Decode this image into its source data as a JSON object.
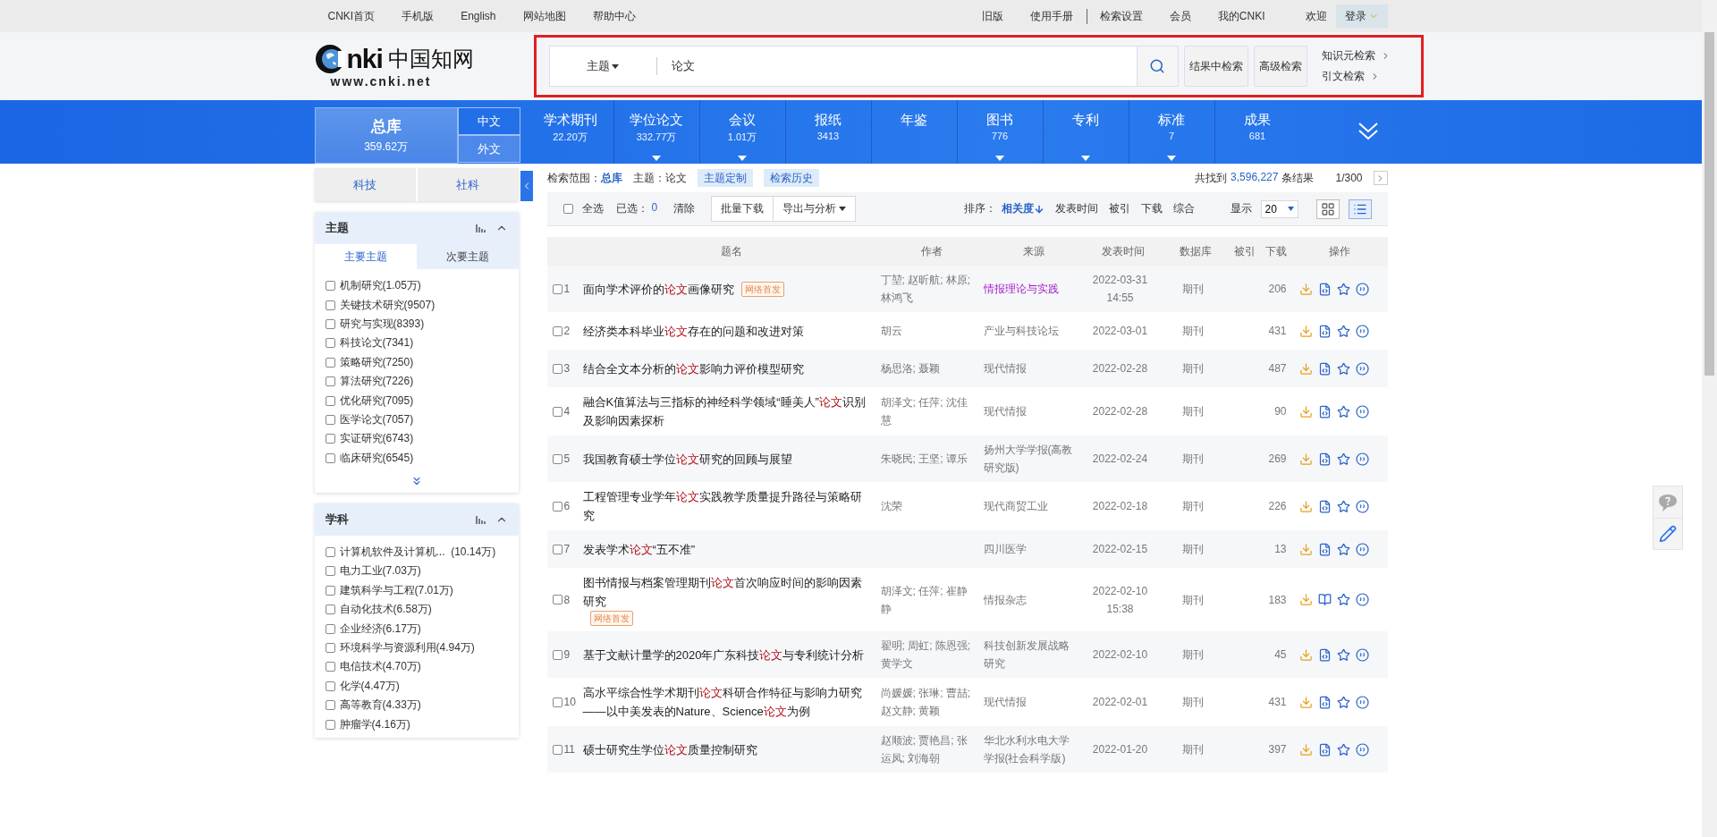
{
  "logo": {
    "wordmark": "nki",
    "name": "中国知网",
    "url": "www.cnki.net"
  },
  "top_links_left": [
    "CNKI首页",
    "手机版",
    "English",
    "网站地图",
    "帮助中心"
  ],
  "top_links_right": [
    {
      "label": "旧版",
      "separated": false
    },
    {
      "label": "使用手册",
      "separated": false
    },
    {
      "label": "检索设置",
      "separated": true
    },
    {
      "label": "会员",
      "separated": false
    },
    {
      "label": "我的CNKI",
      "separated": false
    }
  ],
  "welcome": "欢迎",
  "login": "登录",
  "search": {
    "field": "主题",
    "value": "论文",
    "buttons": [
      "结果中检索",
      "高级检索"
    ],
    "links": [
      "知识元检索",
      "引文检索"
    ]
  },
  "nav": {
    "all_label": "总库",
    "all_count": "359.62万",
    "langs": [
      "中文",
      "外文"
    ],
    "databases": [
      {
        "label": "学术期刊",
        "count": "22.20万",
        "has_menu": false
      },
      {
        "label": "学位论文",
        "count": "332.77万",
        "has_menu": true
      },
      {
        "label": "会议",
        "count": "1.01万",
        "has_menu": true
      },
      {
        "label": "报纸",
        "count": "3413",
        "has_menu": false
      },
      {
        "label": "年鉴",
        "has_menu": false
      },
      {
        "label": "图书",
        "count": "776",
        "has_menu": true
      },
      {
        "label": "专利",
        "has_menu": true
      },
      {
        "label": "标准",
        "count": "7",
        "has_menu": true
      },
      {
        "label": "成果",
        "count": "681",
        "has_menu": false
      }
    ]
  },
  "sidebar": {
    "scopes": [
      "科技",
      "社科"
    ],
    "facets": [
      {
        "title": "主题",
        "tabs": [
          {
            "label": "主要主题",
            "selected": true
          },
          {
            "label": "次要主题",
            "selected": false
          }
        ],
        "more": true,
        "items": [
          {
            "label": "机制研究(1.05万)",
            "checked": false
          },
          {
            "label": "关键技术研究(9507)",
            "checked": false
          },
          {
            "label": "研究与实现(8393)",
            "checked": false
          },
          {
            "label": "科技论文(7341)",
            "checked": false
          },
          {
            "label": "策略研究(7250)",
            "checked": false
          },
          {
            "label": "算法研究(7226)",
            "checked": false
          },
          {
            "label": "优化研究(7095)",
            "checked": false
          },
          {
            "label": "医学论文(7057)",
            "checked": false
          },
          {
            "label": "实证研究(6743)",
            "checked": false
          },
          {
            "label": "临床研究(6545)",
            "checked": false
          }
        ]
      },
      {
        "title": "学科",
        "more": false,
        "items": [
          {
            "label": "计算机软件及计算机...  (10.14万)",
            "checked": false
          },
          {
            "label": "电力工业(7.03万)",
            "checked": false
          },
          {
            "label": "建筑科学与工程(7.01万)",
            "checked": false
          },
          {
            "label": "自动化技术(6.58万)",
            "checked": false
          },
          {
            "label": "企业经济(6.17万)",
            "checked": false
          },
          {
            "label": "环境科学与资源利用(4.94万)",
            "checked": false
          },
          {
            "label": "电信技术(4.70万)",
            "checked": false
          },
          {
            "label": "化学(4.47万)",
            "checked": false
          },
          {
            "label": "高等教育(4.33万)",
            "checked": false
          },
          {
            "label": "肿瘤学(4.16万)",
            "checked": false
          }
        ]
      }
    ]
  },
  "results": {
    "scope_label": "检索范围：",
    "scope": "总库",
    "query": "主题：论文",
    "actions": [
      "主题定制",
      "检索历史"
    ],
    "found_prefix": "共找到",
    "found": "3,596,227",
    "found_suffix": "条结果",
    "page": "1/300"
  },
  "toolbar": {
    "select_all": "全选",
    "select_all_checked": false,
    "selected_label": "已选：",
    "selected_count": "0",
    "clear": "清除",
    "buttons": [
      {
        "label": "批量下载",
        "has_menu": false
      },
      {
        "label": "导出与分析",
        "has_menu": true
      }
    ],
    "sort_label": "排序：",
    "sorts": [
      {
        "label": "相关度",
        "selected": true
      },
      {
        "label": "发表时间",
        "selected": false
      },
      {
        "label": "被引",
        "selected": false
      },
      {
        "label": "下载",
        "selected": false
      },
      {
        "label": "综合",
        "selected": false
      }
    ],
    "show_label": "显示",
    "page_size": "20",
    "views": [
      {
        "kind": "grid",
        "selected": false
      },
      {
        "kind": "list",
        "selected": true
      }
    ]
  },
  "table": {
    "columns": [
      "题名",
      "作者",
      "来源",
      "发表时间",
      "数据库",
      "被引",
      "下载",
      "操作"
    ],
    "rows": [
      {
        "index": "1",
        "checked": false,
        "title": [
          {
            "text": "面向学术评价的",
            "highlight": false
          },
          {
            "text": "论文",
            "highlight": true
          },
          {
            "text": "画像研究",
            "highlight": false
          }
        ],
        "tag": "网络首发",
        "authors": "丁堃; 赵昕航; 林原; 林鸿飞",
        "source": "情报理论与实践",
        "visited": true,
        "date": "2022-03-31 14:55",
        "database": "期刊",
        "downloads": "206",
        "kind": "html"
      },
      {
        "index": "2",
        "checked": false,
        "title": [
          {
            "text": "经济类本科毕业",
            "highlight": false
          },
          {
            "text": "论文",
            "highlight": true
          },
          {
            "text": "存在的问题和改进对策",
            "highlight": false
          }
        ],
        "authors": "胡云",
        "source": "产业与科技论坛",
        "visited": false,
        "date": "2022-03-01",
        "database": "期刊",
        "downloads": "431",
        "kind": "html"
      },
      {
        "index": "3",
        "checked": false,
        "title": [
          {
            "text": "结合全文本分析的",
            "highlight": false
          },
          {
            "text": "论文",
            "highlight": true
          },
          {
            "text": "影响力评价模型研究",
            "highlight": false
          }
        ],
        "authors": "杨思洛; 聂颖",
        "source": "现代情报",
        "visited": false,
        "date": "2022-02-28",
        "database": "期刊",
        "downloads": "487",
        "kind": "html"
      },
      {
        "index": "4",
        "checked": false,
        "title": [
          {
            "text": "融合K值算法与三指标的神经科学领域“睡美人”",
            "highlight": false
          },
          {
            "text": "论文",
            "highlight": true
          },
          {
            "text": "识别及影响因素探析",
            "highlight": false
          }
        ],
        "authors": "胡泽文; 任萍; 沈佳慧",
        "source": "现代情报",
        "visited": false,
        "date": "2022-02-28",
        "database": "期刊",
        "downloads": "90",
        "kind": "html"
      },
      {
        "index": "5",
        "checked": false,
        "title": [
          {
            "text": "我国教育硕士学位",
            "highlight": false
          },
          {
            "text": "论文",
            "highlight": true
          },
          {
            "text": "研究的回顾与展望",
            "highlight": false
          }
        ],
        "authors": "朱晓民; 王坚; 谭乐",
        "source": "扬州大学学报(高教研究版)",
        "visited": false,
        "date": "2022-02-24",
        "database": "期刊",
        "downloads": "269",
        "kind": "html"
      },
      {
        "index": "6",
        "checked": false,
        "title": [
          {
            "text": "工程管理专业学年",
            "highlight": false
          },
          {
            "text": "论文",
            "highlight": true
          },
          {
            "text": "实践教学质量提升路径与策略研究",
            "highlight": false
          }
        ],
        "authors": "沈荣",
        "source": "现代商贸工业",
        "visited": false,
        "date": "2022-02-18",
        "database": "期刊",
        "downloads": "226",
        "kind": "html"
      },
      {
        "index": "7",
        "checked": false,
        "title": [
          {
            "text": "发表学术",
            "highlight": false
          },
          {
            "text": "论文",
            "highlight": true
          },
          {
            "text": "“五不准”",
            "highlight": false
          }
        ],
        "source": "四川医学",
        "visited": false,
        "date": "2022-02-15",
        "database": "期刊",
        "downloads": "13",
        "kind": "html"
      },
      {
        "index": "8",
        "checked": false,
        "title": [
          {
            "text": "图书情报与档案管理期刊",
            "highlight": false
          },
          {
            "text": "论文",
            "highlight": true
          },
          {
            "text": "首次响应时间的影响因素研究",
            "highlight": false
          }
        ],
        "tag": "网络首发",
        "authors": "胡泽文; 任萍; 崔静静",
        "source": "情报杂志",
        "visited": false,
        "date": "2022-02-10 15:38",
        "database": "期刊",
        "downloads": "183",
        "kind": "book"
      },
      {
        "index": "9",
        "checked": false,
        "title": [
          {
            "text": "基于文献计量学的2020年广东科技",
            "highlight": false
          },
          {
            "text": "论文",
            "highlight": true
          },
          {
            "text": "与专利统计分析",
            "highlight": false
          }
        ],
        "authors": "翟明; 周虹; 陈恩强; 黄学文",
        "source": "科技创新发展战略研究",
        "visited": false,
        "date": "2022-02-10",
        "database": "期刊",
        "downloads": "45",
        "kind": "html"
      },
      {
        "index": "10",
        "checked": false,
        "title": [
          {
            "text": "高水平综合性学术期刊",
            "highlight": false
          },
          {
            "text": "论文",
            "highlight": true
          },
          {
            "text": "科研合作特征与影响力研究——以中美发表的Nature、Science",
            "highlight": false
          },
          {
            "text": "论文",
            "highlight": true
          },
          {
            "text": "为例",
            "highlight": false
          }
        ],
        "authors": "尚媛媛; 张琳; 曹喆; 赵文静; 黄颖",
        "source": "现代情报",
        "visited": false,
        "date": "2022-02-01",
        "database": "期刊",
        "downloads": "431",
        "kind": "html"
      },
      {
        "index": "11",
        "checked": false,
        "title": [
          {
            "text": "硕士研究生学位",
            "highlight": false
          },
          {
            "text": "论文",
            "highlight": true
          },
          {
            "text": "质量控制研究",
            "highlight": false
          }
        ],
        "authors": "赵顺波; 贾艳昌; 张运凤; 刘海朝",
        "source": "华北水利水电大学学报(社会科学版)",
        "visited": false,
        "date": "2022-01-20",
        "database": "期刊",
        "downloads": "397",
        "kind": "html"
      }
    ]
  }
}
